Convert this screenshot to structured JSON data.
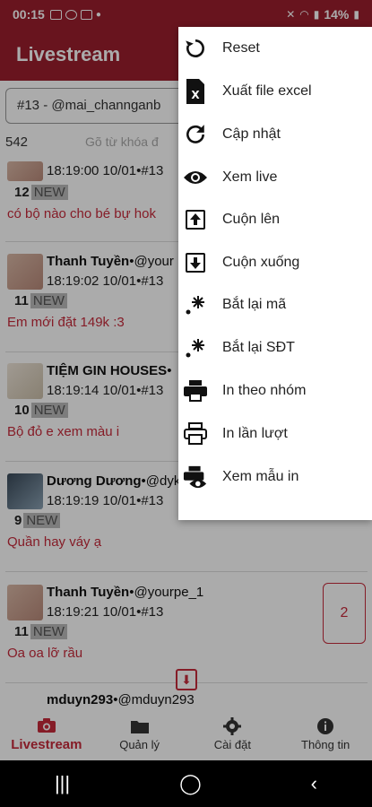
{
  "status_bar": {
    "time": "00:15",
    "battery": "14%"
  },
  "app_bar": {
    "title": "Livestream"
  },
  "filter": {
    "selected": "#13 - @mai_channganb"
  },
  "list": {
    "count": "542",
    "search_placeholder": "Gõ từ khóa đ",
    "items": [
      {
        "name": "",
        "handle": "",
        "time": "18:19:00 10/01•#13",
        "num": "12",
        "badge": "NEW",
        "comment": "có bộ nào cho bé bự hok"
      },
      {
        "name": "Thanh Tuyền",
        "handle": "•@your",
        "time": "18:19:02 10/01•#13",
        "num": "11",
        "badge": "NEW",
        "comment": "Em mới đặt 149k :3"
      },
      {
        "name": "TIỆM GIN HOUSES",
        "handle": "•",
        "time": "18:19:14 10/01•#13",
        "num": "10",
        "badge": "NEW",
        "comment": "Bộ đỏ e xem màu i"
      },
      {
        "name": "Dương Dương",
        "handle": "•@dyk",
        "time": "18:19:19 10/01•#13",
        "num": "9",
        "badge": "NEW",
        "comment": "Quần hay váy ạ"
      },
      {
        "name": "Thanh Tuyền",
        "handle": "•@yourpe_1",
        "time": "18:19:21 10/01•#13",
        "num": "11",
        "badge": "NEW",
        "comment": "Oa oa lỡ rầu",
        "order": "2"
      },
      {
        "name": "mduyn293",
        "handle": "•@mduyn293"
      }
    ]
  },
  "menu": {
    "items": [
      {
        "label": "Reset",
        "icon": "reset-icon"
      },
      {
        "label": "Xuất file excel",
        "icon": "excel-icon"
      },
      {
        "label": "Cập nhật",
        "icon": "refresh-icon"
      },
      {
        "label": "Xem live",
        "icon": "eye-icon"
      },
      {
        "label": "Cuộn lên",
        "icon": "scroll-up-icon"
      },
      {
        "label": "Cuộn xuống",
        "icon": "scroll-down-icon"
      },
      {
        "label": "Bắt lại mã",
        "icon": "sparkle-icon"
      },
      {
        "label": "Bắt lại SĐT",
        "icon": "sparkle-icon"
      },
      {
        "label": "In theo nhóm",
        "icon": "printer-icon"
      },
      {
        "label": "In lần lượt",
        "icon": "printer-outline-icon"
      },
      {
        "label": "Xem mẫu in",
        "icon": "print-preview-icon"
      }
    ]
  },
  "bottom_nav": {
    "items": [
      {
        "label": "Livestream",
        "icon": "camera-icon"
      },
      {
        "label": "Quản lý",
        "icon": "folder-icon"
      },
      {
        "label": "Cài đặt",
        "icon": "gear-icon"
      },
      {
        "label": "Thông tin",
        "icon": "info-icon"
      }
    ]
  },
  "colors": {
    "brand": "#9c1f2e",
    "accent": "#c62a3b"
  }
}
